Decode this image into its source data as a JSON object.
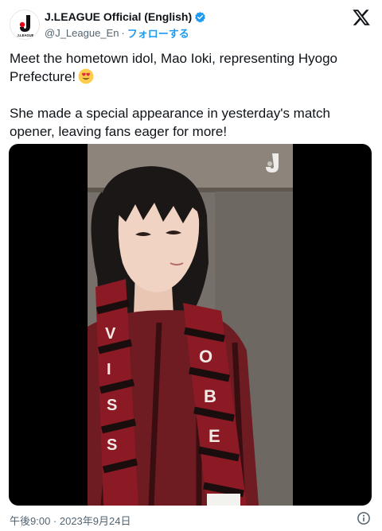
{
  "account": {
    "display_name": "J.LEAGUE Official (English)",
    "handle": "@J_League_En",
    "separator": "·",
    "follow_label": "フォローする",
    "avatar_text": "J.LEAGUE",
    "verified_color": "#1d9bf0"
  },
  "tweet": {
    "line1": "Meet the hometown idol, Mao Ioki, representing Hyogo Prefecture!",
    "line2": "She made a special appearance in yesterday's match opener, leaving fans eager for more!",
    "emoji": "smiling-face-with-heart-eyes"
  },
  "media": {
    "type": "video",
    "description_icon": "j-league-watermark-icon",
    "scarf_color": "#8b1a24"
  },
  "footer": {
    "timestamp": "午後9:00 · 2023年9月24日"
  },
  "icons": {
    "brand": "x-logo-icon",
    "info": "info-icon"
  },
  "colors": {
    "text": "#0f1419",
    "secondary": "#536471",
    "link": "#1d9bf0"
  }
}
